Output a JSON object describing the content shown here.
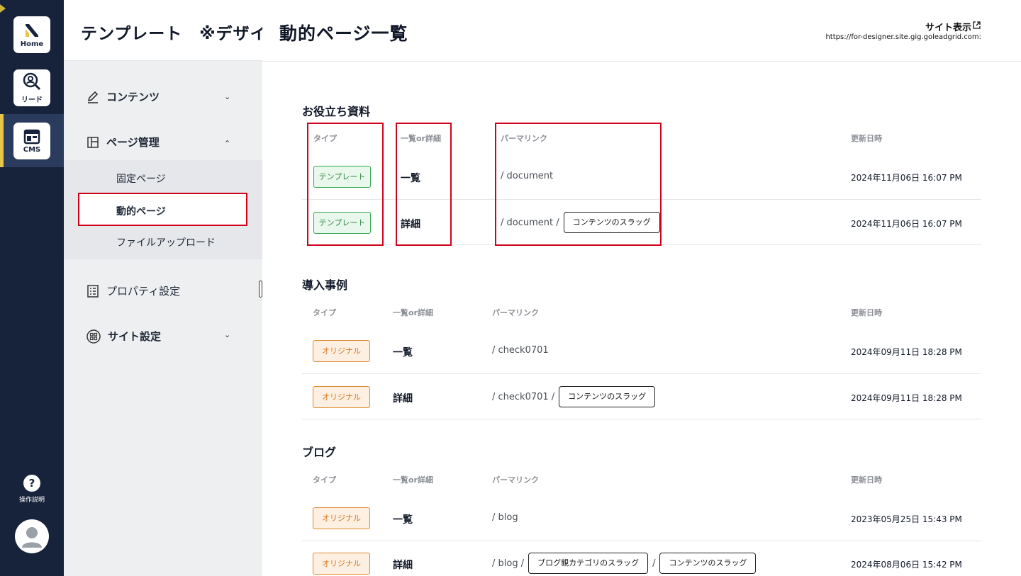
{
  "rail": {
    "home_label": "Home",
    "lead_label": "リード",
    "cms_label": "CMS",
    "help_label": "操作説明",
    "help_glyph": "?"
  },
  "sidebar": {
    "header_title": "テンプレート　※デザイナー",
    "content_label": "コンテンツ",
    "page_mgmt_label": "ページ管理",
    "sub_items": [
      "固定ページ",
      "動的ページ",
      "ファイルアップロード"
    ],
    "property_label": "プロパティ設定",
    "site_settings_label": "サイト設定"
  },
  "header": {
    "title": "動的ページ一覧",
    "site_link": "サイト表示",
    "site_url": "https://for-designer.site.gig.goleadgrid.com:"
  },
  "columns": {
    "type": "タイプ",
    "kind": "一覧or詳細",
    "permalink": "パーマリンク",
    "updated": "更新日時"
  },
  "sections": [
    {
      "title": "お役立ち資料",
      "rows": [
        {
          "type": "テンプレート",
          "kind": "一覧",
          "path": "/ document",
          "slugs": [],
          "date": "2024年11月06日 16:07 PM"
        },
        {
          "type": "テンプレート",
          "kind": "詳細",
          "path": "/ document /",
          "slugs": [
            "コンテンツのスラッグ"
          ],
          "date": "2024年11月06日 16:07 PM"
        }
      ]
    },
    {
      "title": "導入事例",
      "rows": [
        {
          "type": "オリジナル",
          "kind": "一覧",
          "path": "/ check0701",
          "slugs": [],
          "date": "2024年09月11日 18:28 PM"
        },
        {
          "type": "オリジナル",
          "kind": "詳細",
          "path": "/ check0701 /",
          "slugs": [
            "コンテンツのスラッグ"
          ],
          "date": "2024年09月11日 18:28 PM"
        }
      ]
    },
    {
      "title": "ブログ",
      "rows": [
        {
          "type": "オリジナル",
          "kind": "一覧",
          "path": "/ blog",
          "slugs": [],
          "date": "2023年05月25日 15:43 PM"
        },
        {
          "type": "オリジナル",
          "kind": "詳細",
          "path": "/ blog /",
          "slugs": [
            "ブログ親カテゴリのスラッグ",
            "コンテンツのスラッグ"
          ],
          "date": "2024年08月06日 15:42 PM"
        }
      ]
    }
  ],
  "colors": {
    "rail_bg": "#17223b",
    "rail_accent": "#e8c547",
    "highlight": "#d0021b",
    "template_badge": "#34a853",
    "original_badge": "#e08a2e"
  }
}
